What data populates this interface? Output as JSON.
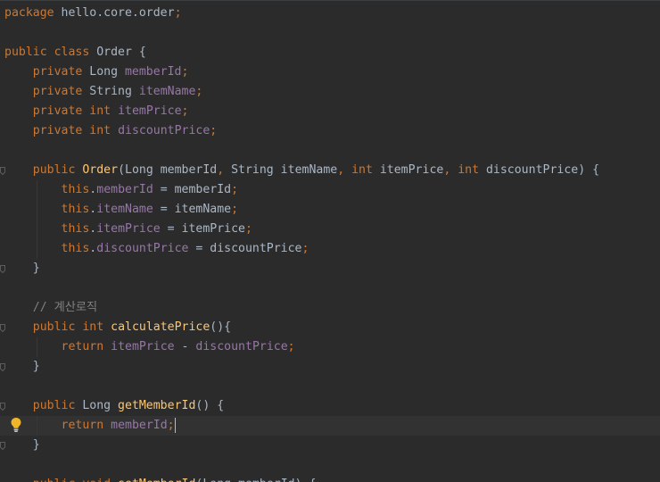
{
  "editor": {
    "lines": [
      [
        {
          "t": "package",
          "c": "kw"
        },
        {
          "t": " hello.core.order"
        },
        {
          "t": ";",
          "c": "kw"
        }
      ],
      [],
      [
        {
          "t": "public",
          "c": "kw"
        },
        {
          "t": " "
        },
        {
          "t": "class",
          "c": "kw"
        },
        {
          "t": " Order {"
        }
      ],
      [
        {
          "t": "    "
        },
        {
          "t": "private",
          "c": "kw"
        },
        {
          "t": " Long "
        },
        {
          "t": "memberId",
          "c": "fld"
        },
        {
          "t": ";",
          "c": "kw"
        }
      ],
      [
        {
          "t": "    "
        },
        {
          "t": "private",
          "c": "kw"
        },
        {
          "t": " String "
        },
        {
          "t": "itemName",
          "c": "fld"
        },
        {
          "t": ";",
          "c": "kw"
        }
      ],
      [
        {
          "t": "    "
        },
        {
          "t": "private",
          "c": "kw"
        },
        {
          "t": " "
        },
        {
          "t": "int",
          "c": "kw"
        },
        {
          "t": " "
        },
        {
          "t": "itemPrice",
          "c": "fld"
        },
        {
          "t": ";",
          "c": "kw"
        }
      ],
      [
        {
          "t": "    "
        },
        {
          "t": "private",
          "c": "kw"
        },
        {
          "t": " "
        },
        {
          "t": "int",
          "c": "kw"
        },
        {
          "t": " "
        },
        {
          "t": "discountPrice",
          "c": "fld"
        },
        {
          "t": ";",
          "c": "kw"
        }
      ],
      [],
      [
        {
          "t": "    "
        },
        {
          "t": "public",
          "c": "kw"
        },
        {
          "t": " "
        },
        {
          "t": "Order",
          "c": "mdecl"
        },
        {
          "t": "(Long memberId"
        },
        {
          "t": ", ",
          "c": "kw"
        },
        {
          "t": "String itemName"
        },
        {
          "t": ", ",
          "c": "kw"
        },
        {
          "t": "int",
          "c": "kw"
        },
        {
          "t": " itemPrice"
        },
        {
          "t": ", ",
          "c": "kw"
        },
        {
          "t": "int",
          "c": "kw"
        },
        {
          "t": " discountPrice) {"
        }
      ],
      [
        {
          "t": "        "
        },
        {
          "t": "this",
          "c": "kw"
        },
        {
          "t": "."
        },
        {
          "t": "memberId",
          "c": "fld"
        },
        {
          "t": " = memberId"
        },
        {
          "t": ";",
          "c": "kw"
        }
      ],
      [
        {
          "t": "        "
        },
        {
          "t": "this",
          "c": "kw"
        },
        {
          "t": "."
        },
        {
          "t": "itemName",
          "c": "fld"
        },
        {
          "t": " = itemName"
        },
        {
          "t": ";",
          "c": "kw"
        }
      ],
      [
        {
          "t": "        "
        },
        {
          "t": "this",
          "c": "kw"
        },
        {
          "t": "."
        },
        {
          "t": "itemPrice",
          "c": "fld"
        },
        {
          "t": " = itemPrice"
        },
        {
          "t": ";",
          "c": "kw"
        }
      ],
      [
        {
          "t": "        "
        },
        {
          "t": "this",
          "c": "kw"
        },
        {
          "t": "."
        },
        {
          "t": "discountPrice",
          "c": "fld"
        },
        {
          "t": " = discountPrice"
        },
        {
          "t": ";",
          "c": "kw"
        }
      ],
      [
        {
          "t": "    }"
        }
      ],
      [],
      [
        {
          "t": "    "
        },
        {
          "t": "// 계산로직",
          "c": "cmt"
        }
      ],
      [
        {
          "t": "    "
        },
        {
          "t": "public",
          "c": "kw"
        },
        {
          "t": " "
        },
        {
          "t": "int",
          "c": "kw"
        },
        {
          "t": " "
        },
        {
          "t": "calculatePrice",
          "c": "mdecl"
        },
        {
          "t": "(){"
        }
      ],
      [
        {
          "t": "        "
        },
        {
          "t": "return",
          "c": "kw"
        },
        {
          "t": " "
        },
        {
          "t": "itemPrice",
          "c": "fld"
        },
        {
          "t": " - "
        },
        {
          "t": "discountPrice",
          "c": "fld"
        },
        {
          "t": ";",
          "c": "kw"
        }
      ],
      [
        {
          "t": "    }"
        }
      ],
      [],
      [
        {
          "t": "    "
        },
        {
          "t": "public",
          "c": "kw"
        },
        {
          "t": " Long "
        },
        {
          "t": "getMemberId",
          "c": "mdecl"
        },
        {
          "t": "() {"
        }
      ],
      [
        {
          "t": "        "
        },
        {
          "t": "return",
          "c": "kw"
        },
        {
          "t": " "
        },
        {
          "t": "memberId",
          "c": "fld"
        },
        {
          "t": ";",
          "c": "kw"
        }
      ],
      [
        {
          "t": "    }"
        }
      ],
      [],
      [
        {
          "t": "    "
        },
        {
          "t": "public",
          "c": "kw"
        },
        {
          "t": " "
        },
        {
          "t": "void",
          "c": "kw"
        },
        {
          "t": " "
        },
        {
          "t": "setMemberId",
          "c": "mdecl"
        },
        {
          "t": "(Long memberId) {"
        }
      ]
    ],
    "current_line": 21,
    "fold_markers": [
      8,
      13,
      16,
      18,
      20,
      22
    ],
    "intention_bulb_line": 21
  }
}
